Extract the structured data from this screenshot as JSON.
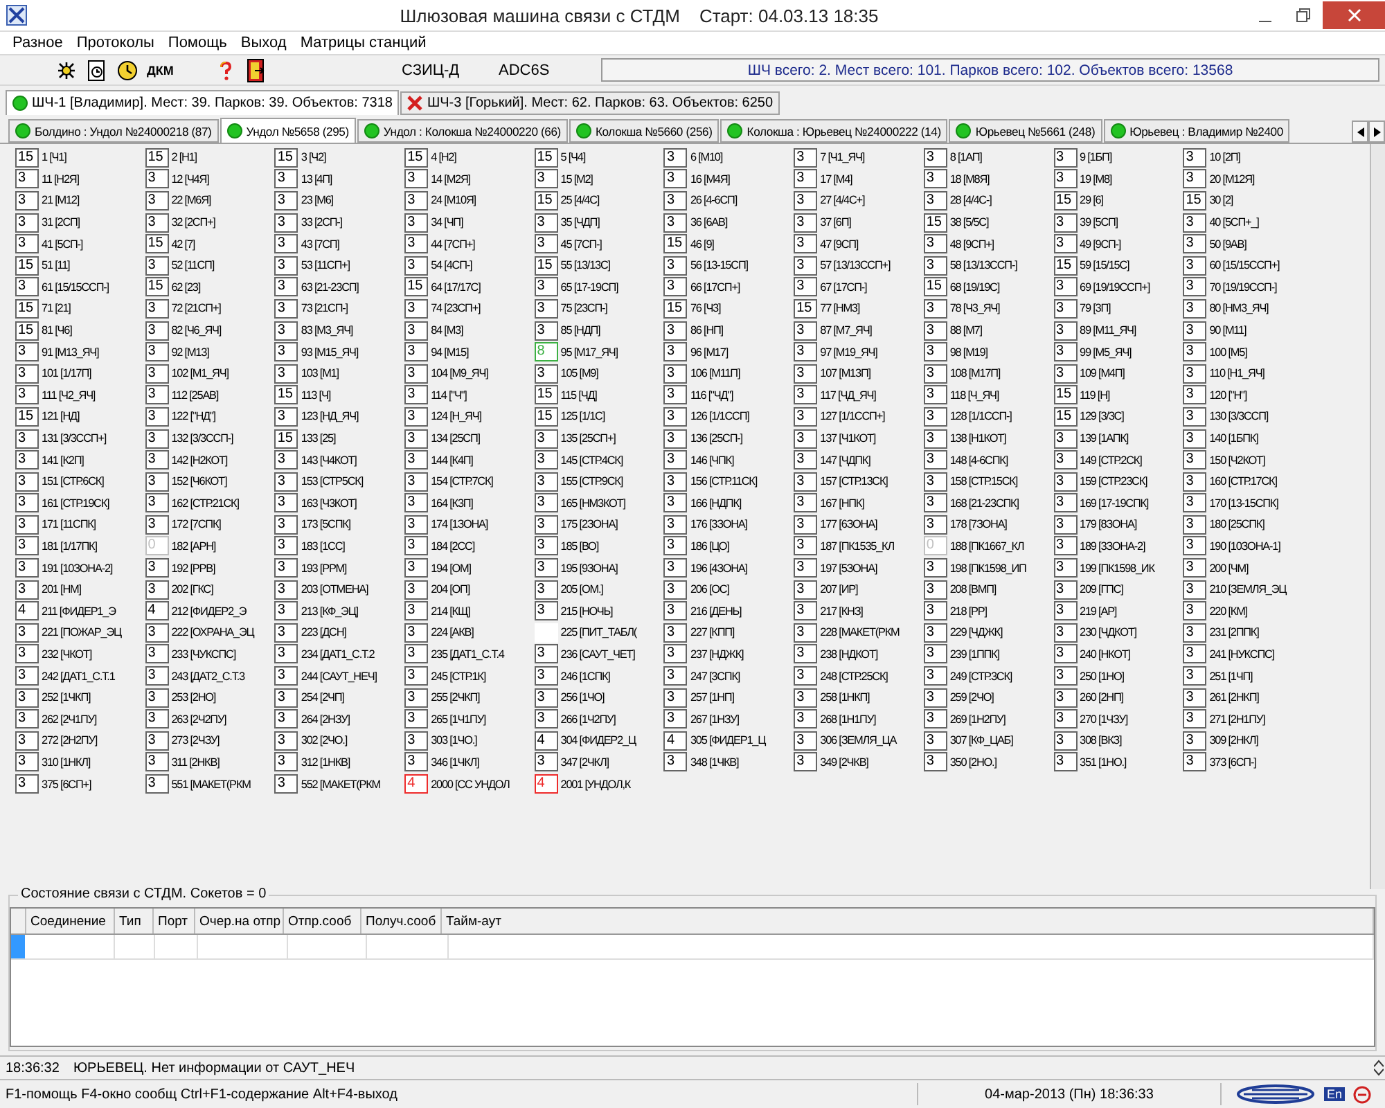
{
  "window": {
    "title": "Шлюзовая машина связи с СТДМ",
    "start": "Старт: 04.03.13 18:35"
  },
  "menu": [
    "Разное",
    "Протоколы",
    "Помощь",
    "Выход",
    "Матрицы станций"
  ],
  "toolbar": {
    "dkm": "ДКМ",
    "labels": [
      "СЗИЦ-Д",
      "ADC6S"
    ],
    "summary": "ШЧ всего: 2. Мест всего: 101. Парков всего: 102. Объектов всего: 13568"
  },
  "division_tabs": [
    {
      "label": "ШЧ-1 [Владимир]. Мест: 39. Парков: 39. Объектов: 7318",
      "selected": true,
      "connected": true
    },
    {
      "label": "ШЧ-3 [Горький]. Мест: 62. Парков: 63. Объектов: 6250",
      "selected": false,
      "connected": false
    }
  ],
  "station_tabs": [
    {
      "label": "Болдино : Ундол №24000218 (87)",
      "selected": false,
      "connected": true
    },
    {
      "label": "Ундол №5658 (295)",
      "selected": true,
      "connected": true
    },
    {
      "label": "Ундол : Колокша №24000220 (66)",
      "selected": false,
      "connected": true
    },
    {
      "label": "Колокша №5660 (256)",
      "selected": false,
      "connected": true
    },
    {
      "label": "Колокша : Юрьевец №24000222 (14)",
      "selected": false,
      "connected": true
    },
    {
      "label": "Юрьевец №5661 (248)",
      "selected": false,
      "connected": true
    },
    {
      "label": "Юрьевец : Владимир №2400",
      "selected": false,
      "connected": true
    }
  ],
  "grid": {
    "rows": [
      {
        "cells": [
          {
            "value": "15",
            "label": "1 [Ч1]",
            "color": "#646464"
          },
          {
            "value": "15",
            "label": "2 [Н1]",
            "color": "#646464"
          },
          {
            "value": "15",
            "label": "3 [Ч2]",
            "color": "#646464"
          },
          {
            "value": "15",
            "label": "4 [Н2]",
            "color": "#646464"
          },
          {
            "value": "15",
            "label": "5 [Ч4]",
            "color": "#646464"
          },
          {
            "value": "3",
            "label": "6 [М10]",
            "color": "#646464"
          },
          {
            "value": "3",
            "label": "7 [Ч1_ЯЧ]",
            "color": "#646464"
          },
          {
            "value": "3",
            "label": "8 [1АП]",
            "color": "#646464"
          },
          {
            "value": "3",
            "label": "9 [1БП]",
            "color": "#646464"
          },
          {
            "value": "3",
            "label": "10 [2П]",
            "color": "#646464"
          }
        ]
      },
      {
        "cells": [
          {
            "value": "3",
            "label": "11 [Н2Я]",
            "color": "#646464"
          },
          {
            "value": "3",
            "label": "12 [Ч4Я]",
            "color": "#646464"
          },
          {
            "value": "3",
            "label": "13 [4П]",
            "color": "#646464"
          },
          {
            "value": "3",
            "label": "14 [М2Я]",
            "color": "#646464"
          },
          {
            "value": "3",
            "label": "15 [М2]",
            "color": "#646464"
          },
          {
            "value": "3",
            "label": "16 [М4Я]",
            "color": "#646464"
          },
          {
            "value": "3",
            "label": "17 [М4]",
            "color": "#646464"
          },
          {
            "value": "3",
            "label": "18 [М8Я]",
            "color": "#646464"
          },
          {
            "value": "3",
            "label": "19 [М8]",
            "color": "#646464"
          },
          {
            "value": "3",
            "label": "20 [М12Я]",
            "color": "#646464"
          }
        ]
      },
      {
        "cells": [
          {
            "value": "3",
            "label": "21 [М12]",
            "color": "#646464"
          },
          {
            "value": "3",
            "label": "22 [М6Я]",
            "color": "#646464"
          },
          {
            "value": "3",
            "label": "23 [М6]",
            "color": "#646464"
          },
          {
            "value": "3",
            "label": "24 [М10Я]",
            "color": "#646464"
          },
          {
            "value": "15",
            "label": "25 [4/4С]",
            "color": "#646464"
          },
          {
            "value": "3",
            "label": "26 [4-6СП]",
            "color": "#646464"
          },
          {
            "value": "3",
            "label": "27 [4/4С+]",
            "color": "#646464"
          },
          {
            "value": "3",
            "label": "28 [4/4С-]",
            "color": "#646464"
          },
          {
            "value": "15",
            "label": "29 [6]",
            "color": "#646464"
          },
          {
            "value": "15",
            "label": "30 [2]",
            "color": "#646464"
          }
        ]
      },
      {
        "cells": [
          {
            "value": "3",
            "label": "31 [2СП]",
            "color": "#646464"
          },
          {
            "value": "3",
            "label": "32 [2СП+]",
            "color": "#646464"
          },
          {
            "value": "3",
            "label": "33 [2СП-]",
            "color": "#646464"
          },
          {
            "value": "3",
            "label": "34 [ЧП]",
            "color": "#646464"
          },
          {
            "value": "3",
            "label": "35 [ЧДП]",
            "color": "#646464"
          },
          {
            "value": "3",
            "label": "36 [6АВ]",
            "color": "#646464"
          },
          {
            "value": "3",
            "label": "37 [6П]",
            "color": "#646464"
          },
          {
            "value": "15",
            "label": "38 [5/5С]",
            "color": "#646464"
          },
          {
            "value": "3",
            "label": "39 [5СП]",
            "color": "#646464"
          },
          {
            "value": "3",
            "label": "40 [5СП+_]",
            "color": "#646464"
          }
        ]
      },
      {
        "cells": [
          {
            "value": "3",
            "label": "41 [5СП-]",
            "color": "#646464"
          },
          {
            "value": "15",
            "label": "42 [7]",
            "color": "#646464"
          },
          {
            "value": "3",
            "label": "43 [7СП]",
            "color": "#646464"
          },
          {
            "value": "3",
            "label": "44 [7СП+]",
            "color": "#646464"
          },
          {
            "value": "3",
            "label": "45 [7СП-]",
            "color": "#646464"
          },
          {
            "value": "15",
            "label": "46 [9]",
            "color": "#646464"
          },
          {
            "value": "3",
            "label": "47 [9СП]",
            "color": "#646464"
          },
          {
            "value": "3",
            "label": "48 [9СП+]",
            "color": "#646464"
          },
          {
            "value": "3",
            "label": "49 [9СП-]",
            "color": "#646464"
          },
          {
            "value": "3",
            "label": "50 [9АВ]",
            "color": "#646464"
          }
        ]
      },
      {
        "cells": [
          {
            "value": "15",
            "label": "51 [11]",
            "color": "#646464"
          },
          {
            "value": "3",
            "label": "52 [11СП]",
            "color": "#646464"
          },
          {
            "value": "3",
            "label": "53 [11СП+]",
            "color": "#646464"
          },
          {
            "value": "3",
            "label": "54 [4СП-]",
            "color": "#646464"
          },
          {
            "value": "15",
            "label": "55 [13/13С]",
            "color": "#646464"
          },
          {
            "value": "3",
            "label": "56 [13-15СП]",
            "color": "#646464"
          },
          {
            "value": "3",
            "label": "57 [13/13ССП+]",
            "color": "#646464"
          },
          {
            "value": "3",
            "label": "58 [13/13ССП-]",
            "color": "#646464"
          },
          {
            "value": "15",
            "label": "59 [15/15С]",
            "color": "#646464"
          },
          {
            "value": "3",
            "label": "60 [15/15ССП+]",
            "color": "#646464"
          }
        ]
      },
      {
        "cells": [
          {
            "value": "3",
            "label": "61 [15/15ССП-]",
            "color": "#646464"
          },
          {
            "value": "15",
            "label": "62 [23]",
            "color": "#646464"
          },
          {
            "value": "3",
            "label": "63 [21-23СП]",
            "color": "#646464"
          },
          {
            "value": "15",
            "label": "64 [17/17С]",
            "color": "#646464"
          },
          {
            "value": "3",
            "label": "65 [17-19СП]",
            "color": "#646464"
          },
          {
            "value": "3",
            "label": "66 [17СП+]",
            "color": "#646464"
          },
          {
            "value": "3",
            "label": "67 [17СП-]",
            "color": "#646464"
          },
          {
            "value": "15",
            "label": "68 [19/19С]",
            "color": "#646464"
          },
          {
            "value": "3",
            "label": "69 [19/19ССП+]",
            "color": "#646464"
          },
          {
            "value": "3",
            "label": "70 [19/19ССП-]",
            "color": "#646464"
          }
        ]
      },
      {
        "cells": [
          {
            "value": "15",
            "label": "71 [21]",
            "color": "#646464"
          },
          {
            "value": "3",
            "label": "72 [21СП+]",
            "color": "#646464"
          },
          {
            "value": "3",
            "label": "73 [21СП-]",
            "color": "#646464"
          },
          {
            "value": "3",
            "label": "74 [23СП+]",
            "color": "#646464"
          },
          {
            "value": "3",
            "label": "75 [23СП-]",
            "color": "#646464"
          },
          {
            "value": "15",
            "label": "76 [Ч3]",
            "color": "#646464"
          },
          {
            "value": "15",
            "label": "77 [НМ3]",
            "color": "#646464"
          },
          {
            "value": "3",
            "label": "78 [Ч3_ЯЧ]",
            "color": "#646464"
          },
          {
            "value": "3",
            "label": "79 [3П]",
            "color": "#646464"
          },
          {
            "value": "3",
            "label": "80 [НМ3_ЯЧ]",
            "color": "#646464"
          }
        ]
      },
      {
        "cells": [
          {
            "value": "15",
            "label": "81 [Ч6]",
            "color": "#646464"
          },
          {
            "value": "3",
            "label": "82 [Ч6_ЯЧ]",
            "color": "#646464"
          },
          {
            "value": "3",
            "label": "83 [М3_ЯЧ]",
            "color": "#646464"
          },
          {
            "value": "3",
            "label": "84 [М3]",
            "color": "#646464"
          },
          {
            "value": "3",
            "label": "85 [НДП]",
            "color": "#646464"
          },
          {
            "value": "3",
            "label": "86 [НП]",
            "color": "#646464"
          },
          {
            "value": "3",
            "label": "87 [М7_ЯЧ]",
            "color": "#646464"
          },
          {
            "value": "3",
            "label": "88 [М7]",
            "color": "#646464"
          },
          {
            "value": "3",
            "label": "89 [М11_ЯЧ]",
            "color": "#646464"
          },
          {
            "value": "3",
            "label": "90 [М11]",
            "color": "#646464"
          }
        ]
      },
      {
        "cells": [
          {
            "value": "3",
            "label": "91 [М13_ЯЧ]",
            "color": "#646464"
          },
          {
            "value": "3",
            "label": "92 [М13]",
            "color": "#646464"
          },
          {
            "value": "3",
            "label": "93 [М15_ЯЧ]",
            "color": "#646464"
          },
          {
            "value": "3",
            "label": "94 [М15]",
            "color": "#646464"
          },
          {
            "value": "8",
            "label": "95 [М17_ЯЧ]",
            "color": "#3cb043"
          },
          {
            "value": "3",
            "label": "96 [М17]",
            "color": "#646464"
          },
          {
            "value": "3",
            "label": "97 [М19_ЯЧ]",
            "color": "#646464"
          },
          {
            "value": "3",
            "label": "98 [М19]",
            "color": "#646464"
          },
          {
            "value": "3",
            "label": "99 [М5_ЯЧ]",
            "color": "#646464"
          },
          {
            "value": "3",
            "label": "100 [М5]",
            "color": "#646464"
          }
        ]
      },
      {
        "cells": [
          {
            "value": "3",
            "label": "101 [1/17П]",
            "color": "#646464"
          },
          {
            "value": "3",
            "label": "102 [М1_ЯЧ]",
            "color": "#646464"
          },
          {
            "value": "3",
            "label": "103 [М1]",
            "color": "#646464"
          },
          {
            "value": "3",
            "label": "104 [М9_ЯЧ]",
            "color": "#646464"
          },
          {
            "value": "3",
            "label": "105 [М9]",
            "color": "#646464"
          },
          {
            "value": "3",
            "label": "106 [М11П]",
            "color": "#646464"
          },
          {
            "value": "3",
            "label": "107 [М13П]",
            "color": "#646464"
          },
          {
            "value": "3",
            "label": "108 [М17П]",
            "color": "#646464"
          },
          {
            "value": "3",
            "label": "109 [М4П]",
            "color": "#646464"
          },
          {
            "value": "3",
            "label": "110 [Н1_ЯЧ]",
            "color": "#646464"
          }
        ]
      },
      {
        "cells": [
          {
            "value": "3",
            "label": "111 [Ч2_ЯЧ]",
            "color": "#646464"
          },
          {
            "value": "3",
            "label": "112 [25АВ]",
            "color": "#646464"
          },
          {
            "value": "15",
            "label": "113 [Ч]",
            "color": "#646464"
          },
          {
            "value": "3",
            "label": "114 [\"Ч\"]",
            "color": "#646464"
          },
          {
            "value": "15",
            "label": "115 [ЧД]",
            "color": "#646464"
          },
          {
            "value": "3",
            "label": "116 [\"ЧД\"]",
            "color": "#646464"
          },
          {
            "value": "3",
            "label": "117 [ЧД_ЯЧ]",
            "color": "#646464"
          },
          {
            "value": "3",
            "label": "118 [Ч_ЯЧ]",
            "color": "#646464"
          },
          {
            "value": "15",
            "label": "119 [Н]",
            "color": "#646464"
          },
          {
            "value": "3",
            "label": "120 [\"Н\"]",
            "color": "#646464"
          }
        ]
      },
      {
        "cells": [
          {
            "value": "15",
            "label": "121 [НД]",
            "color": "#646464"
          },
          {
            "value": "3",
            "label": "122 [\"НД\"]",
            "color": "#646464"
          },
          {
            "value": "3",
            "label": "123 [НД_ЯЧ]",
            "color": "#646464"
          },
          {
            "value": "3",
            "label": "124 [Н_ЯЧ]",
            "color": "#646464"
          },
          {
            "value": "15",
            "label": "125 [1/1С]",
            "color": "#646464"
          },
          {
            "value": "3",
            "label": "126 [1/1ССП]",
            "color": "#646464"
          },
          {
            "value": "3",
            "label": "127 [1/1ССП+]",
            "color": "#646464"
          },
          {
            "value": "3",
            "label": "128 [1/1ССП-]",
            "color": "#646464"
          },
          {
            "value": "15",
            "label": "129 [3/3С]",
            "color": "#646464"
          },
          {
            "value": "3",
            "label": "130 [3/3ССП]",
            "color": "#646464"
          }
        ]
      },
      {
        "cells": [
          {
            "value": "3",
            "label": "131 [3/3ССП+]",
            "color": "#646464"
          },
          {
            "value": "3",
            "label": "132 [3/3ССП-]",
            "color": "#646464"
          },
          {
            "value": "15",
            "label": "133 [25]",
            "color": "#646464"
          },
          {
            "value": "3",
            "label": "134 [25СП]",
            "color": "#646464"
          },
          {
            "value": "3",
            "label": "135 [25СП+]",
            "color": "#646464"
          },
          {
            "value": "3",
            "label": "136 [25СП-]",
            "color": "#646464"
          },
          {
            "value": "3",
            "label": "137 [Ч1КОТ]",
            "color": "#646464"
          },
          {
            "value": "3",
            "label": "138 [Н1КОТ]",
            "color": "#646464"
          },
          {
            "value": "3",
            "label": "139 [1АПК]",
            "color": "#646464"
          },
          {
            "value": "3",
            "label": "140 [1БПК]",
            "color": "#646464"
          }
        ]
      },
      {
        "cells": [
          {
            "value": "3",
            "label": "141 [К2П]",
            "color": "#646464"
          },
          {
            "value": "3",
            "label": "142 [Н2КОТ]",
            "color": "#646464"
          },
          {
            "value": "3",
            "label": "143 [Ч4КОТ]",
            "color": "#646464"
          },
          {
            "value": "3",
            "label": "144 [К4П]",
            "color": "#646464"
          },
          {
            "value": "3",
            "label": "145 [СТР.4СК]",
            "color": "#646464"
          },
          {
            "value": "3",
            "label": "146 [ЧПК]",
            "color": "#646464"
          },
          {
            "value": "3",
            "label": "147 [ЧДПК]",
            "color": "#646464"
          },
          {
            "value": "3",
            "label": "148 [4-6СПК]",
            "color": "#646464"
          },
          {
            "value": "3",
            "label": "149 [СТР.2СК]",
            "color": "#646464"
          },
          {
            "value": "3",
            "label": "150 [Ч2КОТ]",
            "color": "#646464"
          }
        ]
      },
      {
        "cells": [
          {
            "value": "3",
            "label": "151 [СТР.6СК]",
            "color": "#646464"
          },
          {
            "value": "3",
            "label": "152 [Ч6КОТ]",
            "color": "#646464"
          },
          {
            "value": "3",
            "label": "153 [СТР5СК]",
            "color": "#646464"
          },
          {
            "value": "3",
            "label": "154 [СТР.7СК]",
            "color": "#646464"
          },
          {
            "value": "3",
            "label": "155 [СТР.9СК]",
            "color": "#646464"
          },
          {
            "value": "3",
            "label": "156 [СТР.11СК]",
            "color": "#646464"
          },
          {
            "value": "3",
            "label": "157 [СТР.13СК]",
            "color": "#646464"
          },
          {
            "value": "3",
            "label": "158 [СТР.15СК]",
            "color": "#646464"
          },
          {
            "value": "3",
            "label": "159 [СТР.23СК]",
            "color": "#646464"
          },
          {
            "value": "3",
            "label": "160 [СТР.17СК]",
            "color": "#646464"
          }
        ]
      },
      {
        "cells": [
          {
            "value": "3",
            "label": "161 [СТР.19СК]",
            "color": "#646464"
          },
          {
            "value": "3",
            "label": "162 [СТР.21СК]",
            "color": "#646464"
          },
          {
            "value": "3",
            "label": "163 [Ч3КОТ]",
            "color": "#646464"
          },
          {
            "value": "3",
            "label": "164 [К3П]",
            "color": "#646464"
          },
          {
            "value": "3",
            "label": "165 [НМ3КОТ]",
            "color": "#646464"
          },
          {
            "value": "3",
            "label": "166 [НДПК]",
            "color": "#646464"
          },
          {
            "value": "3",
            "label": "167 [НПК]",
            "color": "#646464"
          },
          {
            "value": "3",
            "label": "168 [21-23СПК]",
            "color": "#646464"
          },
          {
            "value": "3",
            "label": "169 [17-19СПК]",
            "color": "#646464"
          },
          {
            "value": "3",
            "label": "170 [13-15СПК]",
            "color": "#646464"
          }
        ]
      },
      {
        "cells": [
          {
            "value": "3",
            "label": "171 [11СПК]",
            "color": "#646464"
          },
          {
            "value": "3",
            "label": "172 [7СПК]",
            "color": "#646464"
          },
          {
            "value": "3",
            "label": "173 [5СПК]",
            "color": "#646464"
          },
          {
            "value": "3",
            "label": "174 [1ЗОНА]",
            "color": "#646464"
          },
          {
            "value": "3",
            "label": "175 [2ЗОНА]",
            "color": "#646464"
          },
          {
            "value": "3",
            "label": "176 [3ЗОНА]",
            "color": "#646464"
          },
          {
            "value": "3",
            "label": "177 [6ЗОНА]",
            "color": "#646464"
          },
          {
            "value": "3",
            "label": "178 [7ЗОНА]",
            "color": "#646464"
          },
          {
            "value": "3",
            "label": "179 [8ЗОНА]",
            "color": "#646464"
          },
          {
            "value": "3",
            "label": "180 [25СПК]",
            "color": "#646464"
          }
        ]
      },
      {
        "cells": [
          {
            "value": "3",
            "label": "181 [1/17ПК]",
            "color": "#646464"
          },
          {
            "value": "0",
            "label": "182 [АРН]",
            "color": "#c0c0c0"
          },
          {
            "value": "3",
            "label": "183 [1СС]",
            "color": "#646464"
          },
          {
            "value": "3",
            "label": "184 [2СС]",
            "color": "#646464"
          },
          {
            "value": "3",
            "label": "185 [ВО]",
            "color": "#646464"
          },
          {
            "value": "3",
            "label": "186 [ЦО]",
            "color": "#646464"
          },
          {
            "value": "3",
            "label": "187 [ПК1535_КЛ",
            "color": "#646464"
          },
          {
            "value": "0",
            "label": "188 [ПК1667_КЛ",
            "color": "#c0c0c0"
          },
          {
            "value": "3",
            "label": "189 [3ЗОНА-2]",
            "color": "#646464"
          },
          {
            "value": "3",
            "label": "190 [10ЗОНА-1]",
            "color": "#646464"
          }
        ]
      },
      {
        "cells": [
          {
            "value": "3",
            "label": "191 [10ЗОНА-2]",
            "color": "#646464"
          },
          {
            "value": "3",
            "label": "192 [РРВ]",
            "color": "#646464"
          },
          {
            "value": "3",
            "label": "193 [РРМ]",
            "color": "#646464"
          },
          {
            "value": "3",
            "label": "194 [ОМ]",
            "color": "#646464"
          },
          {
            "value": "3",
            "label": "195 [9ЗОНА]",
            "color": "#646464"
          },
          {
            "value": "3",
            "label": "196 [4ЗОНА]",
            "color": "#646464"
          },
          {
            "value": "3",
            "label": "197 [5ЗОНА]",
            "color": "#646464"
          },
          {
            "value": "3",
            "label": "198 [ПК1598_ИП",
            "color": "#646464"
          },
          {
            "value": "3",
            "label": "199 [ПК1598_ИК",
            "color": "#646464"
          },
          {
            "value": "3",
            "label": "200 [ЧМ]",
            "color": "#646464"
          }
        ]
      },
      {
        "cells": [
          {
            "value": "3",
            "label": "201 [НМ]",
            "color": "#646464"
          },
          {
            "value": "3",
            "label": "202 [ГКС]",
            "color": "#646464"
          },
          {
            "value": "3",
            "label": "203 [ОТМЕНА]",
            "color": "#646464"
          },
          {
            "value": "3",
            "label": "204 [ОП]",
            "color": "#646464"
          },
          {
            "value": "3",
            "label": "205 [ОМ.]",
            "color": "#646464"
          },
          {
            "value": "3",
            "label": "206 [ОС]",
            "color": "#646464"
          },
          {
            "value": "3",
            "label": "207 [ИР]",
            "color": "#646464"
          },
          {
            "value": "3",
            "label": "208 [ВМП]",
            "color": "#646464"
          },
          {
            "value": "3",
            "label": "209 [ГПС]",
            "color": "#646464"
          },
          {
            "value": "3",
            "label": "210 [ЗЕМЛЯ_ЭЦ",
            "color": "#646464"
          }
        ]
      },
      {
        "cells": [
          {
            "value": "4",
            "label": "211 [ФИДЕР1_Э",
            "color": "#646464"
          },
          {
            "value": "4",
            "label": "212 [ФИДЕР2_Э",
            "color": "#646464"
          },
          {
            "value": "3",
            "label": "213 [КФ_ЭЦ]",
            "color": "#646464"
          },
          {
            "value": "3",
            "label": "214 [КЩ]",
            "color": "#646464"
          },
          {
            "value": "3",
            "label": "215 [НОЧЬ]",
            "color": "#646464"
          },
          {
            "value": "3",
            "label": "216 [ДЕНЬ]",
            "color": "#646464"
          },
          {
            "value": "3",
            "label": "217 [КНЗ]",
            "color": "#646464"
          },
          {
            "value": "3",
            "label": "218 [РР]",
            "color": "#646464"
          },
          {
            "value": "3",
            "label": "219 [АР]",
            "color": "#646464"
          },
          {
            "value": "3",
            "label": "220 [КМ]",
            "color": "#646464"
          }
        ]
      },
      {
        "cells": [
          {
            "value": "3",
            "label": "221 [ПОЖАР_ЭЦ",
            "color": "#646464"
          },
          {
            "value": "3",
            "label": "222 [ОХРАНА_ЭЦ",
            "color": "#646464"
          },
          {
            "value": "3",
            "label": "223 [ДСН]",
            "color": "#646464"
          },
          {
            "value": "3",
            "label": "224 [АКВ]",
            "color": "#646464"
          },
          {
            "label": "225 [ПИТ_ТАБЛ(",
            "color": "#ffffff"
          },
          {
            "value": "3",
            "label": "227 [КПП]",
            "color": "#646464"
          },
          {
            "value": "3",
            "label": "228 [МАКЕТ(РКМ",
            "color": "#646464"
          },
          {
            "value": "3",
            "label": "229 [ЧДЖК]",
            "color": "#646464"
          },
          {
            "value": "3",
            "label": "230 [ЧДКОТ]",
            "color": "#646464"
          },
          {
            "value": "3",
            "label": "231 [2ППК]",
            "color": "#646464"
          }
        ]
      },
      {
        "cells": [
          {
            "value": "3",
            "label": "232 [ЧКОТ]",
            "color": "#646464"
          },
          {
            "value": "3",
            "label": "233 [ЧУКСПС]",
            "color": "#646464"
          },
          {
            "value": "3",
            "label": "234 [ДАТ1_С.Т.2",
            "color": "#646464"
          },
          {
            "value": "3",
            "label": "235 [ДАТ1_С.Т.4",
            "color": "#646464"
          },
          {
            "value": "3",
            "label": "236 [САУТ_ЧЕТ]",
            "color": "#646464"
          },
          {
            "value": "3",
            "label": "237 [НДЖК]",
            "color": "#646464"
          },
          {
            "value": "3",
            "label": "238 [НДКОТ]",
            "color": "#646464"
          },
          {
            "value": "3",
            "label": "239 [1ППК]",
            "color": "#646464"
          },
          {
            "value": "3",
            "label": "240 [НКОТ]",
            "color": "#646464"
          },
          {
            "value": "3",
            "label": "241 [НУКСПС]",
            "color": "#646464"
          }
        ]
      },
      {
        "cells": [
          {
            "value": "3",
            "label": "242 [ДАТ1_С.Т.1",
            "color": "#646464"
          },
          {
            "value": "3",
            "label": "243 [ДАТ2_С.Т.3",
            "color": "#646464"
          },
          {
            "value": "3",
            "label": "244 [САУТ_НЕЧ]",
            "color": "#646464"
          },
          {
            "value": "3",
            "label": "245 [СТР.1К]",
            "color": "#646464"
          },
          {
            "value": "3",
            "label": "246 [1СПК]",
            "color": "#646464"
          },
          {
            "value": "3",
            "label": "247 [3СПК]",
            "color": "#646464"
          },
          {
            "value": "3",
            "label": "248 [СТР.25СК]",
            "color": "#646464"
          },
          {
            "value": "3",
            "label": "249 [СТР.3СК]",
            "color": "#646464"
          },
          {
            "value": "3",
            "label": "250 [1НО]",
            "color": "#646464"
          },
          {
            "value": "3",
            "label": "251 [1ЧП]",
            "color": "#646464"
          }
        ]
      },
      {
        "cells": [
          {
            "value": "3",
            "label": "252 [1ЧКП]",
            "color": "#646464"
          },
          {
            "value": "3",
            "label": "253 [2НО]",
            "color": "#646464"
          },
          {
            "value": "3",
            "label": "254 [2ЧП]",
            "color": "#646464"
          },
          {
            "value": "3",
            "label": "255 [2ЧКП]",
            "color": "#646464"
          },
          {
            "value": "3",
            "label": "256 [1ЧО]",
            "color": "#646464"
          },
          {
            "value": "3",
            "label": "257 [1НП]",
            "color": "#646464"
          },
          {
            "value": "3",
            "label": "258 [1НКП]",
            "color": "#646464"
          },
          {
            "value": "3",
            "label": "259 [2ЧО]",
            "color": "#646464"
          },
          {
            "value": "3",
            "label": "260 [2НП]",
            "color": "#646464"
          },
          {
            "value": "3",
            "label": "261 [2НКП]",
            "color": "#646464"
          }
        ]
      },
      {
        "cells": [
          {
            "value": "3",
            "label": "262 [2Ч1ПУ]",
            "color": "#646464"
          },
          {
            "value": "3",
            "label": "263 [2Ч2ПУ]",
            "color": "#646464"
          },
          {
            "value": "3",
            "label": "264 [2НЗУ]",
            "color": "#646464"
          },
          {
            "value": "3",
            "label": "265 [1Ч1ПУ]",
            "color": "#646464"
          },
          {
            "value": "3",
            "label": "266 [1Ч2ПУ]",
            "color": "#646464"
          },
          {
            "value": "3",
            "label": "267 [1НЗУ]",
            "color": "#646464"
          },
          {
            "value": "3",
            "label": "268 [1Н1ПУ]",
            "color": "#646464"
          },
          {
            "value": "3",
            "label": "269 [1Н2ПУ]",
            "color": "#646464"
          },
          {
            "value": "3",
            "label": "270 [1ЧЗУ]",
            "color": "#646464"
          },
          {
            "value": "3",
            "label": "271 [2Н1ПУ]",
            "color": "#646464"
          }
        ]
      },
      {
        "cells": [
          {
            "value": "3",
            "label": "272 [2Н2ПУ]",
            "color": "#646464"
          },
          {
            "value": "3",
            "label": "273 [2ЧЗУ]",
            "color": "#646464"
          },
          {
            "value": "3",
            "label": "302 [2ЧО.]",
            "color": "#646464"
          },
          {
            "value": "3",
            "label": "303 [1ЧО.]",
            "color": "#646464"
          },
          {
            "value": "4",
            "label": "304 [ФИДЕР2_Ц",
            "color": "#646464"
          },
          {
            "value": "4",
            "label": "305 [ФИДЕР1_Ц",
            "color": "#646464"
          },
          {
            "value": "3",
            "label": "306 [ЗЕМЛЯ_ЦА",
            "color": "#646464"
          },
          {
            "value": "3",
            "label": "307 [КФ_ЦАБ]",
            "color": "#646464"
          },
          {
            "value": "3",
            "label": "308 [ВКЗ]",
            "color": "#646464"
          },
          {
            "value": "3",
            "label": "309 [2НКЛ]",
            "color": "#646464"
          }
        ]
      },
      {
        "cells": [
          {
            "value": "3",
            "label": "310 [1НКЛ]",
            "color": "#646464"
          },
          {
            "value": "3",
            "label": "311 [2НКВ]",
            "color": "#646464"
          },
          {
            "value": "3",
            "label": "312 [1НКВ]",
            "color": "#646464"
          },
          {
            "value": "3",
            "label": "346 [1ЧКЛ]",
            "color": "#646464"
          },
          {
            "value": "3",
            "label": "347 [2ЧКЛ]",
            "color": "#646464"
          },
          {
            "value": "3",
            "label": "348 [1ЧКВ]",
            "color": "#646464"
          },
          {
            "value": "3",
            "label": "349 [2ЧКВ]",
            "color": "#646464"
          },
          {
            "value": "3",
            "label": "350 [2НО.]",
            "color": "#646464"
          },
          {
            "value": "3",
            "label": "351 [1НО.]",
            "color": "#646464"
          },
          {
            "value": "3",
            "label": "373 [6СП-]",
            "color": "#646464"
          }
        ]
      },
      {
        "cells": [
          {
            "value": "3",
            "label": "375 [6СП+]",
            "color": "#646464"
          },
          {
            "value": "3",
            "label": "551 [МАКЕТ(РКМ",
            "color": "#646464"
          },
          {
            "value": "3",
            "label": "552 [МАКЕТ(РКМ",
            "color": "#646464"
          },
          {
            "value": "4",
            "label": "2000 [СС УНДОЛ",
            "color": "#ee2b2b"
          },
          {
            "value": "4",
            "label": "2001 [УНДОЛ,К",
            "color": "#ee2b2b"
          }
        ]
      }
    ]
  },
  "connection_panel": {
    "title": "Состояние связи с СТДМ. Сокетов = 0",
    "columns": [
      "Соединение",
      "Тип",
      "Порт",
      "Очер.на отпр",
      "Отпр.сооб",
      "Получ.сооб",
      "Тайм-аут"
    ]
  },
  "message": {
    "time": "18:36:32",
    "text": "ЮРЬЕВЕЦ. Нет информации от САУТ_НЕЧ"
  },
  "status_bar": {
    "hint": "F1-помощь F4-окно сообщ Ctrl+F1-содержание Alt+F4-выход",
    "datetime": "04-мар-2013 (Пн) 18:36:33",
    "language": "En"
  }
}
